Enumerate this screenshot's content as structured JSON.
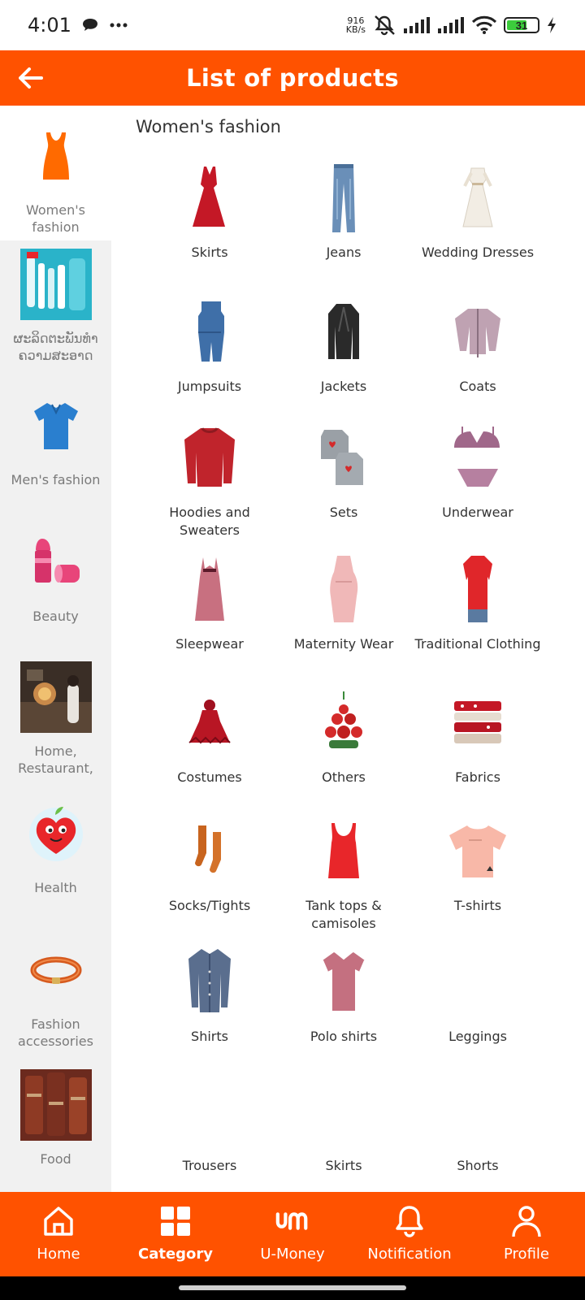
{
  "status_bar": {
    "time": "4:01",
    "net_speed_value": "916",
    "net_speed_unit": "KB/s",
    "battery": "31"
  },
  "header": {
    "title": "List of products"
  },
  "sidebar": {
    "items": [
      {
        "label": "Women's fashion",
        "icon": "tank-top-icon"
      },
      {
        "label": "ຜະລິດຕະພັນທຳຄວາມສະອາດພາຍ...",
        "icon": "oral-care-products-image"
      },
      {
        "label": "Men's fashion",
        "icon": "polo-shirt-icon"
      },
      {
        "label": "Beauty",
        "icon": "lipstick-icon"
      },
      {
        "label": "Home, Restaurant, Hotel",
        "icon": "restaurant-photo"
      },
      {
        "label": "Health",
        "icon": "heart-mascot-icon"
      },
      {
        "label": "Fashion accessories",
        "icon": "bracelet-icon"
      },
      {
        "label": "Food",
        "icon": "dried-meat-image"
      }
    ]
  },
  "section": {
    "title": "Women's fashion"
  },
  "products": [
    {
      "label": "Skirts",
      "icon": "red-dress-icon"
    },
    {
      "label": "Jeans",
      "icon": "jeans-icon"
    },
    {
      "label": "Wedding Dresses",
      "icon": "wedding-dress-icon"
    },
    {
      "label": "Jumpsuits",
      "icon": "jumpsuit-icon"
    },
    {
      "label": "Jackets",
      "icon": "jacket-icon"
    },
    {
      "label": "Coats",
      "icon": "cardigan-icon"
    },
    {
      "label": "Hoodies and Sweaters",
      "icon": "sweater-icon"
    },
    {
      "label": "Sets",
      "icon": "couple-sweatshirts-icon"
    },
    {
      "label": "Underwear",
      "icon": "lingerie-icon"
    },
    {
      "label": "Sleepwear",
      "icon": "nightgown-icon"
    },
    {
      "label": "Maternity Wear",
      "icon": "maternity-dress-icon"
    },
    {
      "label": "Traditional Clothing",
      "icon": "traditional-dress-icon"
    },
    {
      "label": "Costumes",
      "icon": "costume-dress-icon"
    },
    {
      "label": "Others",
      "icon": "strawberry-tree-icon"
    },
    {
      "label": "Fabrics",
      "icon": "fabrics-icon"
    },
    {
      "label": "Socks/Tights",
      "icon": "socks-icon"
    },
    {
      "label": "Tank tops & camisoles",
      "icon": "tank-top-icon"
    },
    {
      "label": "T-shirts",
      "icon": "t-shirt-icon"
    },
    {
      "label": "Shirts",
      "icon": "denim-shirt-icon"
    },
    {
      "label": "Polo shirts",
      "icon": "pink-polo-icon"
    },
    {
      "label": "Leggings",
      "icon": ""
    },
    {
      "label": "Trousers",
      "icon": ""
    },
    {
      "label": "Skirts",
      "icon": ""
    },
    {
      "label": "Shorts",
      "icon": ""
    }
  ],
  "bottom_nav": {
    "items": [
      {
        "label": "Home",
        "icon": "home-icon"
      },
      {
        "label": "Category",
        "icon": "grid-icon"
      },
      {
        "label": "U-Money",
        "icon": "umoney-icon"
      },
      {
        "label": "Notification",
        "icon": "bell-icon"
      },
      {
        "label": "Profile",
        "icon": "user-icon"
      }
    ]
  },
  "colors": {
    "brand_orange": "#ff5200",
    "sidebar_bg": "#f1f1f1"
  }
}
